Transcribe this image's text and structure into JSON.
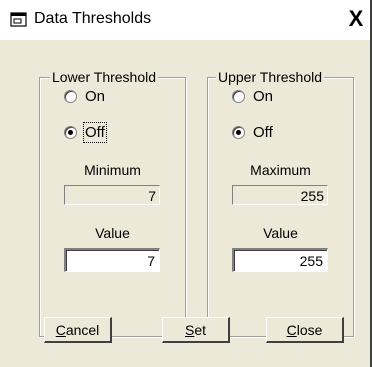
{
  "window": {
    "title": "Data Thresholds",
    "close_glyph": "X"
  },
  "lower": {
    "legend": "Lower Threshold",
    "radio_on_label": "On",
    "radio_off_label": "Off",
    "selected": "Off",
    "minimum_label": "Minimum",
    "minimum_value": "7",
    "value_label": "Value",
    "value": "7"
  },
  "upper": {
    "legend": "Upper Threshold",
    "radio_on_label": "On",
    "radio_off_label": "Off",
    "selected": "Off",
    "maximum_label": "Maximum",
    "maximum_value": "255",
    "value_label": "Value",
    "value": "255"
  },
  "buttons": {
    "cancel": {
      "prefix": "",
      "accel": "C",
      "rest": "ancel"
    },
    "set": {
      "prefix": "",
      "accel": "S",
      "rest": "et"
    },
    "close": {
      "prefix": "",
      "accel": "C",
      "rest": "lose"
    }
  }
}
